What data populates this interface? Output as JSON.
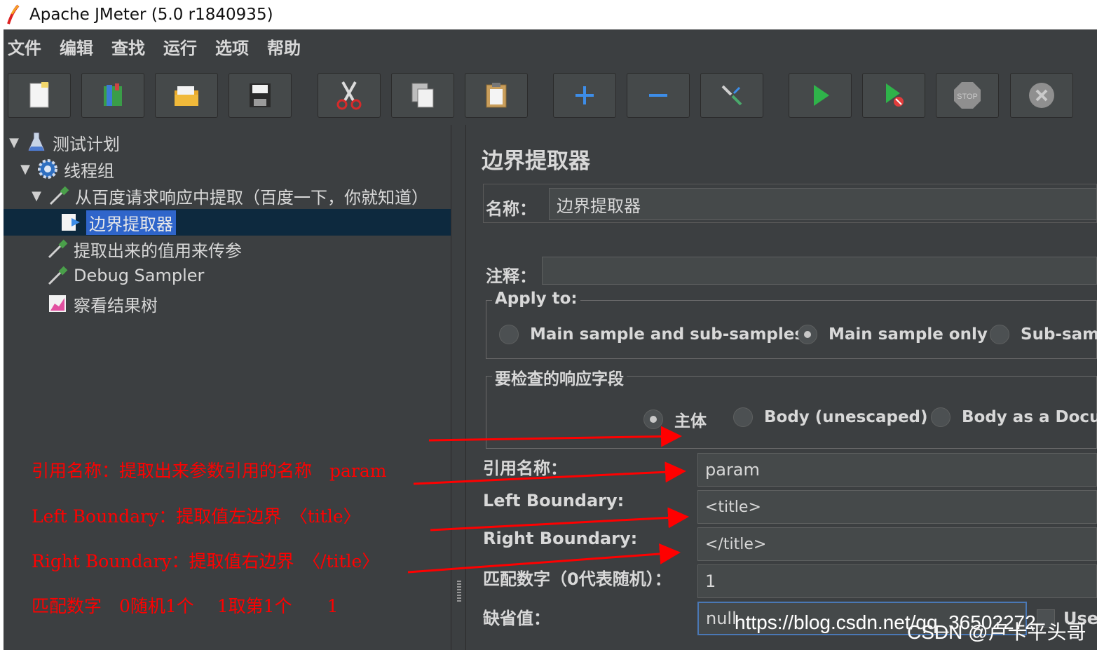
{
  "window": {
    "title": "Apache JMeter (5.0 r1840935)"
  },
  "menu": [
    "文件",
    "编辑",
    "查找",
    "运行",
    "选项",
    "帮助"
  ],
  "toolbar": {
    "buttons": [
      "new-icon",
      "templates-icon",
      "open-icon",
      "save-icon",
      "cut-icon",
      "copy-icon",
      "paste-icon",
      "expand-icon",
      "collapse-icon",
      "toggle-icon",
      "start-icon",
      "start-no-pauses-icon",
      "stop-icon",
      "shutdown-icon"
    ],
    "stop_label": "STOP"
  },
  "tree": {
    "test_plan": "测试计划",
    "thread_group": "线程组",
    "request": "从百度请求响应中提取（百度一下，你就知道）",
    "extractor": "边界提取器",
    "param_request": "提取出来的值用来传参",
    "debug": "Debug Sampler",
    "results": "察看结果树"
  },
  "annotations": {
    "ref_name": "引用名称：提取出来参数引用的名称　param",
    "left": "Left Boundary：提取值左边界　〈title〉",
    "right": "Right Boundary：提取值右边界　〈/title〉",
    "match": "匹配数字　0随机1个　 1取第1个　　1"
  },
  "panel": {
    "title": "边界提取器",
    "name_label": "名称：",
    "name_value": "边界提取器",
    "comment_label": "注释：",
    "comment_value": "",
    "apply_to": {
      "legend": "Apply to:",
      "options": [
        "Main sample and sub-samples",
        "Main sample only",
        "Sub-samp"
      ],
      "selected": "Main sample only"
    },
    "field_to_check": {
      "legend": "要检查的响应字段",
      "options": [
        "主体",
        "Body (unescaped)",
        "Body as a Docum"
      ],
      "selected": "主体"
    },
    "ref_label": "引用名称：",
    "ref_value": "param",
    "left_label": "Left Boundary:",
    "left_value": "<title>",
    "right_label": "Right Boundary:",
    "right_value": "</title>",
    "match_label": "匹配数字（0代表随机）：",
    "match_value": "1",
    "default_label": "缺省值：",
    "default_value": "null",
    "use_empty_label": "Use"
  },
  "watermark": {
    "url": "https://blog.csdn.net/qq_36502272",
    "author": "CSDN @卢卡平头哥"
  },
  "colors": {
    "background": "#3c3f41",
    "selection": "#2f65ca",
    "annotation": "#ff0000"
  }
}
